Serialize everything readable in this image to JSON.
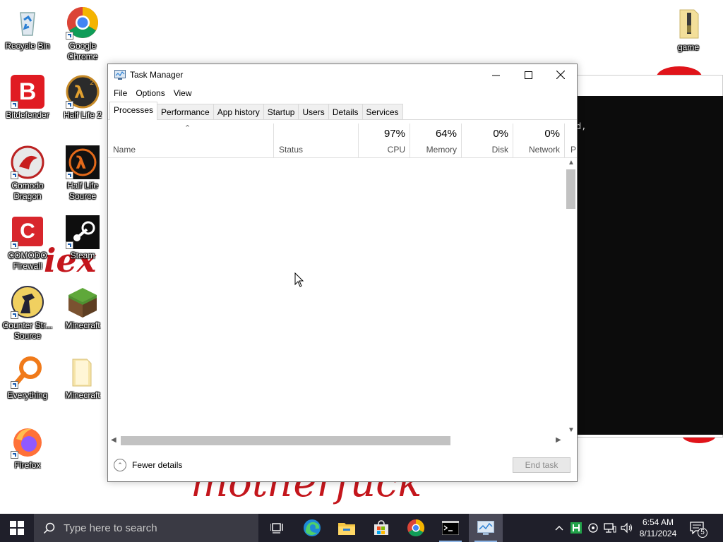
{
  "desktop": {
    "icons": [
      {
        "label": "Recycle Bin"
      },
      {
        "label": "Google Chrome"
      },
      {
        "label": "Bitdefender"
      },
      {
        "label": "Half Life 2"
      },
      {
        "label": "Comodo Dragon"
      },
      {
        "label": "Half Life Source"
      },
      {
        "label": "COMODO Firewall"
      },
      {
        "label": "Steam"
      },
      {
        "label": "Counter Str... Source"
      },
      {
        "label": "Minecraft"
      },
      {
        "label": "Everything"
      },
      {
        "label": "Minecraft"
      },
      {
        "label": "Firefox"
      },
      {
        "label": "game"
      }
    ],
    "wallpaper_text_1": "iex",
    "wallpaper_text_2": "motherfuck"
  },
  "console": {
    "visible_text": "d,"
  },
  "task_manager": {
    "title": "Task Manager",
    "menu": [
      "File",
      "Options",
      "View"
    ],
    "tabs": [
      "Processes",
      "Performance",
      "App history",
      "Startup",
      "Users",
      "Details",
      "Services"
    ],
    "active_tab": "Processes",
    "columns": {
      "name": "Name",
      "status": "Status",
      "cpu": {
        "value": "97%",
        "label": "CPU"
      },
      "memory": {
        "value": "64%",
        "label": "Memory"
      },
      "disk": {
        "value": "0%",
        "label": "Disk"
      },
      "network": {
        "value": "0%",
        "label": "Network"
      },
      "extra": "P"
    },
    "fewer_details": "Fewer details",
    "end_task": "End task"
  },
  "taskbar": {
    "search_placeholder": "Type here to search",
    "clock": {
      "time": "6:54 AM",
      "date": "8/11/2024"
    },
    "notification_count": "5"
  },
  "colors": {
    "taskbar": "#1f1f2a",
    "wallpaper_red": "#c4161c",
    "accent": "#0078d7"
  }
}
